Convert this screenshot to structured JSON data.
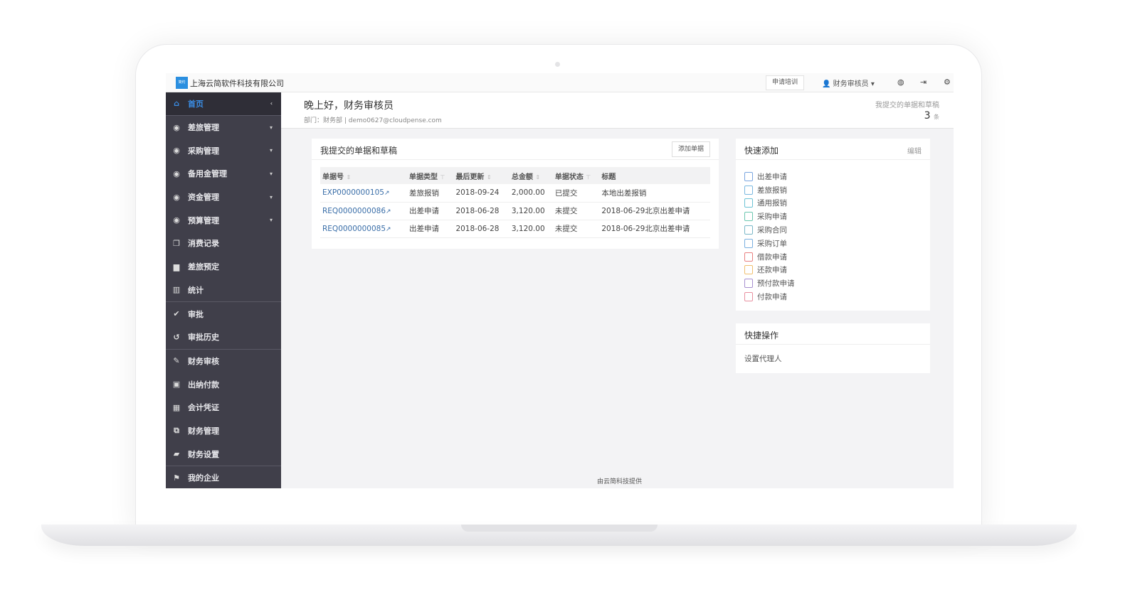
{
  "topbar": {
    "logo_text": "简约",
    "company": "上海云简软件科技有限公司",
    "training_button": "申请培训",
    "user": "财务审核员",
    "user_caret": "▾"
  },
  "sidebar": {
    "items": [
      {
        "label": "首页",
        "icon": "home-icon",
        "glyph": "⌂",
        "right": "‹"
      },
      {
        "label": "差旅管理",
        "icon": "travel-icon",
        "glyph": "◉",
        "right": "▾"
      },
      {
        "label": "采购管理",
        "icon": "purchase-icon",
        "glyph": "◉",
        "right": "▾"
      },
      {
        "label": "备用金管理",
        "icon": "petty-cash-icon",
        "glyph": "◉",
        "right": "▾"
      },
      {
        "label": "资金管理",
        "icon": "fund-icon",
        "glyph": "◉",
        "right": "▾"
      },
      {
        "label": "预算管理",
        "icon": "budget-icon",
        "glyph": "◉",
        "right": "▾"
      },
      {
        "label": "消费记录",
        "icon": "files-icon",
        "glyph": "❐",
        "right": ""
      },
      {
        "label": "差旅预定",
        "icon": "briefcase-icon",
        "glyph": "▆",
        "right": ""
      },
      {
        "label": "统计",
        "icon": "bar-chart-icon",
        "glyph": "▥",
        "right": ""
      },
      {
        "label": "审批",
        "icon": "check-circle-icon",
        "glyph": "✔",
        "right": ""
      },
      {
        "label": "审批历史",
        "icon": "history-icon",
        "glyph": "↺",
        "right": ""
      },
      {
        "label": "财务审核",
        "icon": "edit-icon",
        "glyph": "✎",
        "right": ""
      },
      {
        "label": "出纳付款",
        "icon": "money-icon",
        "glyph": "▣",
        "right": ""
      },
      {
        "label": "会计凭证",
        "icon": "calculator-icon",
        "glyph": "▦",
        "right": ""
      },
      {
        "label": "财务管理",
        "icon": "copy-icon",
        "glyph": "⧉",
        "right": ""
      },
      {
        "label": "财务设置",
        "icon": "book-icon",
        "glyph": "▰",
        "right": ""
      },
      {
        "label": "我的企业",
        "icon": "flag-icon",
        "glyph": "⚑",
        "right": ""
      }
    ]
  },
  "header": {
    "greeting": "晚上好，财务审核员",
    "dept": "部门：财务部 | demo0627@cloudpense.com",
    "summary_label": "我提交的单据和草稿",
    "summary_count": "3",
    "summary_unit": "条"
  },
  "docs": {
    "title": "我提交的单据和草稿",
    "add_button": "添加单据",
    "columns": [
      "单据号",
      "单据类型",
      "最后更新",
      "总金额",
      "单据状态",
      "标题"
    ],
    "rows": [
      [
        "EXP0000000105",
        "差旅报销",
        "2018-09-24",
        "2,000.00",
        "已提交",
        "本地出差报销"
      ],
      [
        "REQ0000000086",
        "出差申请",
        "2018-06-28",
        "3,120.00",
        "未提交",
        "2018-06-29北京出差申请"
      ],
      [
        "REQ0000000085",
        "出差申请",
        "2018-06-28",
        "3,120.00",
        "未提交",
        "2018-06-29北京出差申请"
      ]
    ]
  },
  "quick_add": {
    "title": "快速添加",
    "edit": "编辑",
    "items": [
      {
        "label": "出差申请",
        "color": "#7aa6e0"
      },
      {
        "label": "差旅报销",
        "color": "#7ab8e0"
      },
      {
        "label": "通用报销",
        "color": "#6cc3d6"
      },
      {
        "label": "采购申请",
        "color": "#6cc7b0"
      },
      {
        "label": "采购合同",
        "color": "#7ab8c8"
      },
      {
        "label": "采购订单",
        "color": "#7ab0e0"
      },
      {
        "label": "借款申请",
        "color": "#e88080"
      },
      {
        "label": "还款申请",
        "color": "#f0c070"
      },
      {
        "label": "预付款申请",
        "color": "#a890d0"
      },
      {
        "label": "付款申请",
        "color": "#e890a0"
      }
    ]
  },
  "quick_ops": {
    "title": "快捷操作",
    "items": [
      "设置代理人"
    ]
  },
  "footer": "由云简科技提供"
}
